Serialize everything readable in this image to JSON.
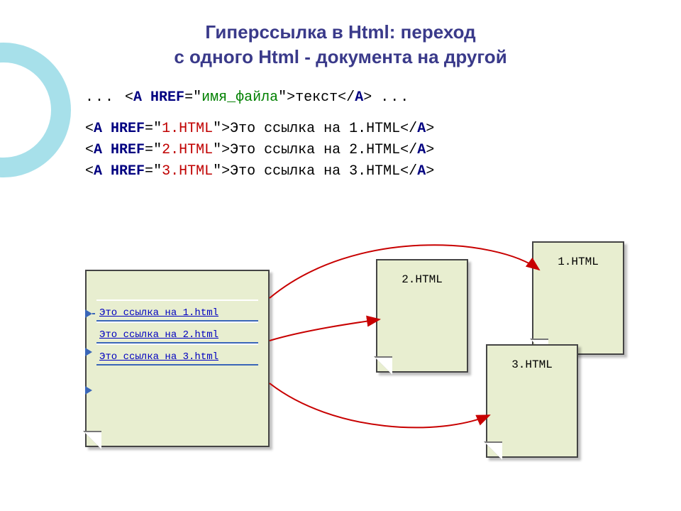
{
  "title_line1": "Гиперссылка  в Html:  переход",
  "title_line2": "с одного Html - документа на другой",
  "syntax": {
    "dots_left": "... ",
    "tag_open_a": "<",
    "a": "A",
    "href": " HREF",
    "eq": "=",
    "qo": "\"",
    "file_label": "имя_файла",
    "qc": "\"",
    "gt": ">",
    "text_label": "текст",
    "close_a": "</",
    "close_gt": ">",
    "dots_right": " ..."
  },
  "examples": [
    {
      "file": "1.HTML",
      "text": "Это ссылка на 1.HTML"
    },
    {
      "file": "2.HTML",
      "text": "Это ссылка на 2.HTML"
    },
    {
      "file": "3.HTML",
      "text": "Это ссылка на 3.HTML"
    }
  ],
  "source_links": [
    "Это ссылка на 1.html",
    "Это ссылка на 2.html",
    "Это ссылка на 3.html"
  ],
  "docs": {
    "p1": "1.HTML",
    "p2": "2.HTML",
    "p3": "3.HTML"
  }
}
